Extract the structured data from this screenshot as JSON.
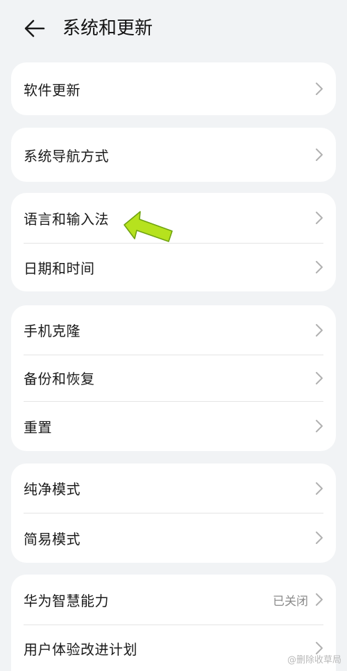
{
  "header": {
    "back_icon": "arrow-left-icon",
    "title": "系统和更新"
  },
  "cards": [
    {
      "items": [
        {
          "label": "软件更新"
        }
      ]
    },
    {
      "items": [
        {
          "label": "系统导航方式"
        }
      ]
    },
    {
      "items": [
        {
          "label": "语言和输入法"
        },
        {
          "label": "日期和时间"
        }
      ]
    },
    {
      "items": [
        {
          "label": "手机克隆"
        },
        {
          "label": "备份和恢复"
        },
        {
          "label": "重置"
        }
      ]
    },
    {
      "items": [
        {
          "label": "纯净模式"
        },
        {
          "label": "简易模式"
        }
      ]
    },
    {
      "items": [
        {
          "label": "华为智慧能力",
          "value": "已关闭"
        },
        {
          "label": "用户体验改进计划"
        }
      ]
    }
  ],
  "watermark": {
    "text": "@删除收草局"
  },
  "colors": {
    "background": "#f1f3f5",
    "card": "#ffffff",
    "chevron": "#b0b0b0",
    "annotation_arrow": "#b6e21e"
  }
}
